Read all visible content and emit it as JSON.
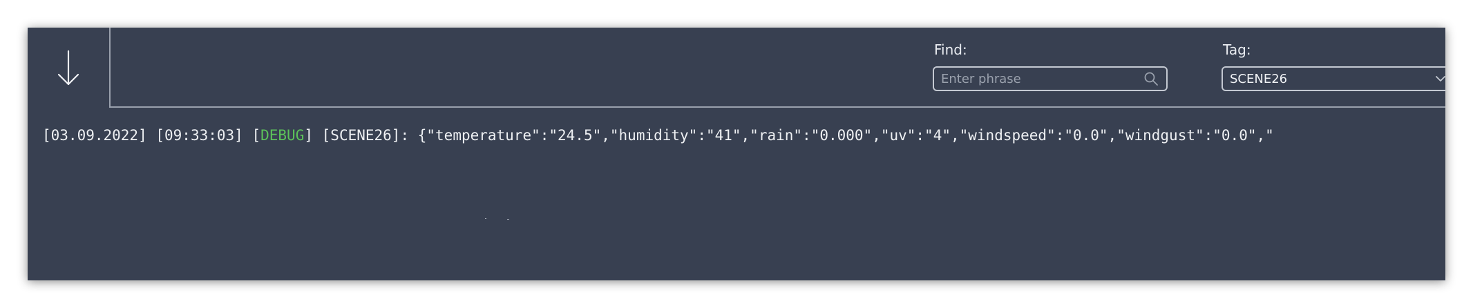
{
  "toolbar": {
    "find_label": "Find:",
    "find_placeholder": "Enter phrase",
    "find_value": "",
    "tag_label": "Tag:",
    "tag_selected": "SCENE26"
  },
  "icons": {
    "scroll": "arrow-down-icon",
    "search": "search-icon",
    "dropdown": "chevron-down-icon"
  },
  "colors": {
    "panel_bg": "#384051",
    "debug_level": "#5cc25a",
    "text": "#eef0f3"
  },
  "log": {
    "lines": [
      {
        "date": "[03.09.2022]",
        "time": "[09:33:03]",
        "level_open": "[",
        "level": "DEBUG",
        "level_close": "]",
        "tag": "[SCENE26]:",
        "message": "{\"temperature\":\"24.5\",\"humidity\":\"41\",\"rain\":\"0.000\",\"uv\":\"4\",\"windspeed\":\"0.0\",\"windgust\":\"0.0\",\""
      }
    ]
  }
}
